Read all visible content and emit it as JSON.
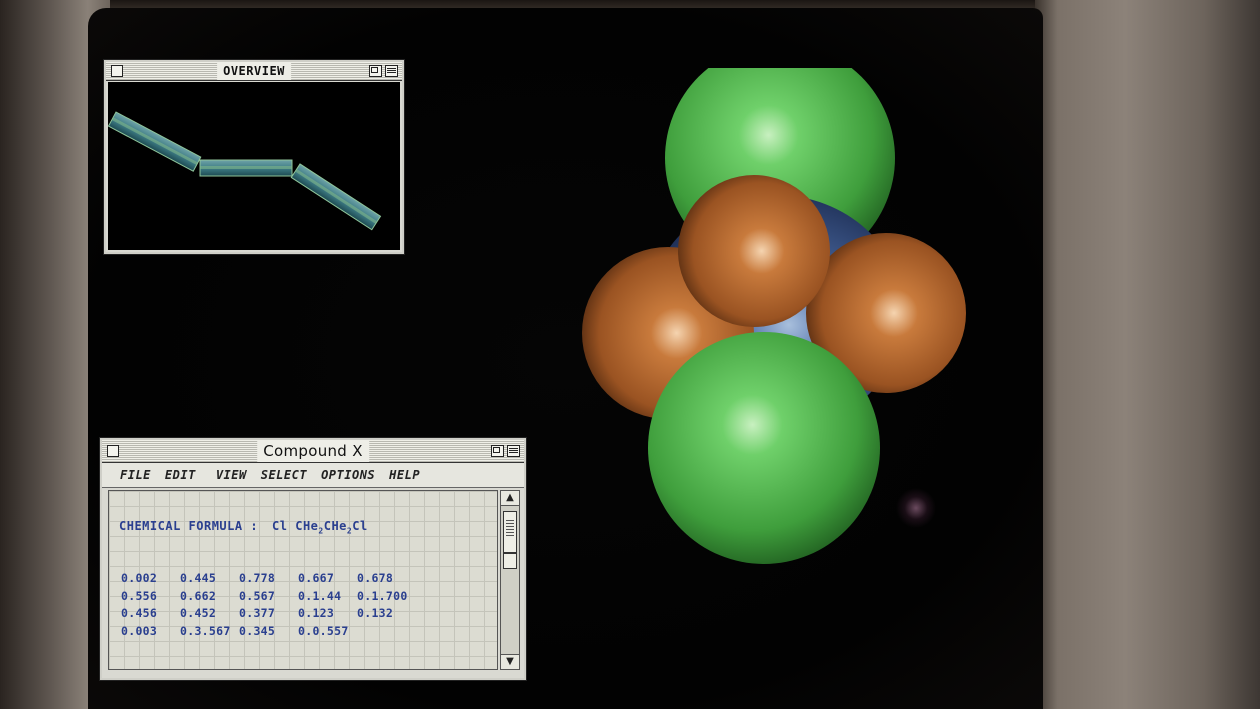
{
  "overview_window": {
    "title": "OVERVIEW"
  },
  "compound_window": {
    "title": "Compound X",
    "menu": [
      "FILE",
      "EDIT",
      "VIEW",
      "SELECT",
      "OPTIONS",
      "HELP"
    ],
    "formula_label": "CHEMICAL FORMULA :",
    "formula_parts": {
      "a": "Cl CHe",
      "sub1": "2",
      "b": "CHe",
      "sub2": "2",
      "c": "Cl"
    },
    "data_rows": [
      [
        "0.002",
        "0.445",
        "0.778",
        "0.667",
        "0.678"
      ],
      [
        "0.556",
        "0.662",
        "0.567",
        "0.1.44",
        "0.1.700"
      ],
      [
        "0.456",
        "0.452",
        "0.377",
        "0.123",
        "0.132"
      ],
      [
        "0.003",
        "0.3.567",
        "0.345",
        "0.0.557"
      ]
    ]
  },
  "colors": {
    "chlorine": "#5fbf5a",
    "hydrogen": "#b5652b",
    "carbon": "#3d5a8f",
    "data_text": "#2a3f8f"
  }
}
